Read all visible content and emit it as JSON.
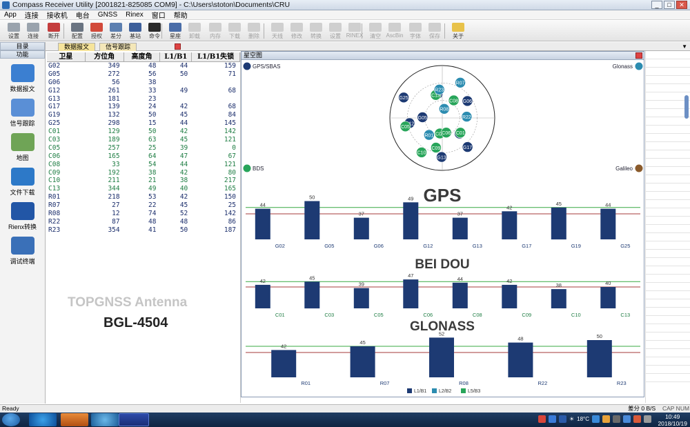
{
  "window": {
    "title": "Compass Receiver Utility [2001821-825085 COM9] - C:\\Users\\stoton\\Documents\\CRU",
    "min": "_",
    "max": "□",
    "close": "✕"
  },
  "menu": [
    "App",
    "连接",
    "接收机",
    "电台",
    "GNSS",
    "Rinex",
    "窗口",
    "帮助"
  ],
  "toolbar": [
    {
      "label": "设置",
      "icon": "settings-icon",
      "color": "#9aa3ad",
      "disabled": false
    },
    {
      "label": "连接",
      "icon": "connect-icon",
      "color": "#9aa3ad",
      "disabled": false
    },
    {
      "label": "断开",
      "icon": "disconnect-icon",
      "color": "#c43d3d",
      "disabled": false
    },
    {
      "label": "配置",
      "icon": "config-icon",
      "color": "#6a7482",
      "disabled": false
    },
    {
      "label": "授权",
      "icon": "license-icon",
      "color": "#d24a3a",
      "disabled": false
    },
    {
      "label": "差分",
      "icon": "differential-icon",
      "color": "#5c7fb0",
      "disabled": false
    },
    {
      "label": "基站",
      "icon": "base-station-icon",
      "color": "#3d5f9a",
      "disabled": false
    },
    {
      "label": "命令",
      "icon": "command-icon",
      "color": "#2b2b2b",
      "disabled": false
    },
    {
      "label": "星座",
      "icon": "constellation-icon",
      "color": "#4a6da8",
      "disabled": false
    },
    {
      "label": "卸载",
      "icon": "unload-icon",
      "color": "#cfcfcf",
      "disabled": true
    },
    {
      "label": "内存",
      "icon": "memory-icon",
      "color": "#cfcfcf",
      "disabled": true
    },
    {
      "label": "下载",
      "icon": "download-icon",
      "color": "#cfcfcf",
      "disabled": true
    },
    {
      "label": "删除",
      "icon": "delete-icon",
      "color": "#cfcfcf",
      "disabled": true
    },
    {
      "label": "天线",
      "icon": "antenna-icon",
      "color": "#cfcfcf",
      "disabled": true
    },
    {
      "label": "修改",
      "icon": "edit-icon",
      "color": "#cfcfcf",
      "disabled": true
    },
    {
      "label": "转换",
      "icon": "convert-icon",
      "color": "#cfcfcf",
      "disabled": true
    },
    {
      "label": "设置",
      "icon": "setup-icon",
      "color": "#cfcfcf",
      "disabled": true
    },
    {
      "label": "RINEX",
      "icon": "rinex-icon",
      "color": "#cfcfcf",
      "disabled": true
    },
    {
      "label": "清空",
      "icon": "clear-icon",
      "color": "#cfcfcf",
      "disabled": true
    },
    {
      "label": "AscBin",
      "icon": "ascbin-icon",
      "color": "#cfcfcf",
      "disabled": true
    },
    {
      "label": "字体",
      "icon": "font-icon",
      "color": "#cfcfcf",
      "disabled": true
    },
    {
      "label": "保存",
      "icon": "save-icon",
      "color": "#cfcfcf",
      "disabled": true
    },
    {
      "label": "关于",
      "icon": "about-icon",
      "color": "#e8c24a",
      "disabled": false
    }
  ],
  "left_panel": {
    "header1": "目录",
    "header2": "功能",
    "items": [
      {
        "label": "数据报文",
        "icon": "mail-icon"
      },
      {
        "label": "信号跟踪",
        "icon": "satellite-icon"
      },
      {
        "label": "地图",
        "icon": "map-icon"
      },
      {
        "label": "文件下载",
        "icon": "download-arrow-icon"
      },
      {
        "label": "Rienx转换",
        "icon": "rinex-logo-icon"
      },
      {
        "label": "调试终端",
        "icon": "terminal-icon"
      }
    ]
  },
  "tabs": [
    {
      "label": "数据报文",
      "active": true
    },
    {
      "label": "信号跟踪",
      "active": false
    }
  ],
  "table": {
    "headers": [
      "卫星",
      "方位角",
      "高度角",
      "L1/B1",
      "L1/B1失锁"
    ],
    "rows": [
      {
        "sat": "G02",
        "az": "349",
        "el": "48",
        "l1": "44",
        "lock": "159",
        "sys": "blue"
      },
      {
        "sat": "G05",
        "az": "272",
        "el": "56",
        "l1": "50",
        "lock": "71",
        "sys": "blue"
      },
      {
        "sat": "G06",
        "az": "56",
        "el": "38",
        "l1": "",
        "lock": "",
        "sys": "blue"
      },
      {
        "sat": "G12",
        "az": "261",
        "el": "33",
        "l1": "49",
        "lock": "68",
        "sys": "blue"
      },
      {
        "sat": "G13",
        "az": "181",
        "el": "23",
        "l1": "",
        "lock": "",
        "sys": "blue"
      },
      {
        "sat": "G17",
        "az": "139",
        "el": "24",
        "l1": "42",
        "lock": "68",
        "sys": "blue"
      },
      {
        "sat": "G19",
        "az": "132",
        "el": "50",
        "l1": "45",
        "lock": "84",
        "sys": "blue"
      },
      {
        "sat": "G25",
        "az": "298",
        "el": "15",
        "l1": "44",
        "lock": "145",
        "sys": "blue"
      },
      {
        "sat": "C01",
        "az": "129",
        "el": "50",
        "l1": "42",
        "lock": "142",
        "sys": "green"
      },
      {
        "sat": "C03",
        "az": "189",
        "el": "63",
        "l1": "45",
        "lock": "121",
        "sys": "green"
      },
      {
        "sat": "C05",
        "az": "257",
        "el": "25",
        "l1": "39",
        "lock": "0",
        "sys": "green"
      },
      {
        "sat": "C06",
        "az": "165",
        "el": "64",
        "l1": "47",
        "lock": "67",
        "sys": "green"
      },
      {
        "sat": "C08",
        "az": "33",
        "el": "54",
        "l1": "44",
        "lock": "121",
        "sys": "green"
      },
      {
        "sat": "C09",
        "az": "192",
        "el": "38",
        "l1": "42",
        "lock": "80",
        "sys": "green"
      },
      {
        "sat": "C10",
        "az": "211",
        "el": "21",
        "l1": "38",
        "lock": "217",
        "sys": "green"
      },
      {
        "sat": "C13",
        "az": "344",
        "el": "49",
        "l1": "40",
        "lock": "165",
        "sys": "green"
      },
      {
        "sat": "R01",
        "az": "218",
        "el": "53",
        "l1": "42",
        "lock": "150",
        "sys": "blue"
      },
      {
        "sat": "R07",
        "az": "27",
        "el": "22",
        "l1": "45",
        "lock": "25",
        "sys": "blue"
      },
      {
        "sat": "R08",
        "az": "12",
        "el": "74",
        "l1": "52",
        "lock": "142",
        "sys": "blue"
      },
      {
        "sat": "R22",
        "az": "87",
        "el": "48",
        "l1": "48",
        "lock": "86",
        "sys": "blue"
      },
      {
        "sat": "R23",
        "az": "354",
        "el": "41",
        "l1": "50",
        "lock": "187",
        "sys": "blue"
      }
    ]
  },
  "overlay": {
    "antenna_text": "TOPGNSS Antenna",
    "model_text": "BGL-4504"
  },
  "sky_window": {
    "title": "星空图",
    "corner_gps": "GPS/SBAS",
    "corner_glonass": "Glonass",
    "corner_bds": "BDS",
    "corner_galileo": "Galileo",
    "colors": {
      "gps": "#1d3a73",
      "glonass": "#2c8cb0",
      "bds": "#28a55a",
      "galileo": "#8a5a2b",
      "ref_green": "#37a840",
      "ref_red": "#a53a3a"
    }
  },
  "chart_data": [
    {
      "type": "bar",
      "title": "GPS",
      "categories": [
        "G02",
        "G05",
        "G06",
        "G12",
        "G13",
        "G17",
        "G19",
        "G25"
      ],
      "values": [
        44,
        50,
        37,
        49,
        37,
        42,
        45,
        44
      ],
      "color": "#1d3a73",
      "label_color": "#1d3a73",
      "ylim": [
        0,
        60
      ]
    },
    {
      "type": "bar",
      "title": "BEI DOU",
      "categories": [
        "C01",
        "C03",
        "C05",
        "C06",
        "C08",
        "C09",
        "C10",
        "C13"
      ],
      "values": [
        42,
        45,
        39,
        47,
        44,
        42,
        38,
        40
      ],
      "color": "#1d3a73",
      "label_color": "#1e7d43",
      "ylim": [
        0,
        60
      ]
    },
    {
      "type": "bar",
      "title": "GLONASS",
      "categories": [
        "R01",
        "R07",
        "R08",
        "R22",
        "R23"
      ],
      "values": [
        42,
        45,
        52,
        48,
        50
      ],
      "color": "#1d3a73",
      "label_color": "#1d3a73",
      "ylim": [
        0,
        60
      ]
    },
    {
      "type": "scatter",
      "title": "",
      "polar": true,
      "points": [
        {
          "id": "G02",
          "az": 349,
          "el": 48,
          "sys": "gps"
        },
        {
          "id": "G05",
          "az": 272,
          "el": 56,
          "sys": "gps"
        },
        {
          "id": "G06",
          "az": 56,
          "el": 38,
          "sys": "gps"
        },
        {
          "id": "G12",
          "az": 261,
          "el": 33,
          "sys": "gps"
        },
        {
          "id": "G13",
          "az": 181,
          "el": 23,
          "sys": "gps"
        },
        {
          "id": "G17",
          "az": 139,
          "el": 24,
          "sys": "gps"
        },
        {
          "id": "G19",
          "az": 132,
          "el": 50,
          "sys": "gps"
        },
        {
          "id": "G25",
          "az": 298,
          "el": 15,
          "sys": "gps"
        },
        {
          "id": "C01",
          "az": 129,
          "el": 50,
          "sys": "bds"
        },
        {
          "id": "C03",
          "az": 189,
          "el": 63,
          "sys": "bds"
        },
        {
          "id": "C05",
          "az": 257,
          "el": 25,
          "sys": "bds"
        },
        {
          "id": "C06",
          "az": 165,
          "el": 64,
          "sys": "bds"
        },
        {
          "id": "C08",
          "az": 33,
          "el": 54,
          "sys": "bds"
        },
        {
          "id": "C09",
          "az": 192,
          "el": 38,
          "sys": "bds"
        },
        {
          "id": "C10",
          "az": 211,
          "el": 21,
          "sys": "bds"
        },
        {
          "id": "C13",
          "az": 344,
          "el": 49,
          "sys": "bds"
        },
        {
          "id": "R01",
          "az": 218,
          "el": 53,
          "sys": "glonass"
        },
        {
          "id": "R07",
          "az": 27,
          "el": 22,
          "sys": "glonass"
        },
        {
          "id": "R08",
          "az": 12,
          "el": 74,
          "sys": "glonass"
        },
        {
          "id": "R22",
          "az": 87,
          "el": 48,
          "sys": "glonass"
        },
        {
          "id": "R23",
          "az": 354,
          "el": 41,
          "sys": "glonass"
        }
      ]
    }
  ],
  "legend": [
    {
      "label": "L1/B1",
      "color": "#1d3a73"
    },
    {
      "label": "L2/B2",
      "color": "#2c8cb0"
    },
    {
      "label": "L5/B3",
      "color": "#28a55a"
    }
  ],
  "status": {
    "ready": "Ready",
    "diff": "差分 0 B/S",
    "cap": "CAP NUM"
  },
  "taskbar": {
    "temp": "18°C",
    "time": "10:49",
    "date": "2018/10/19"
  }
}
